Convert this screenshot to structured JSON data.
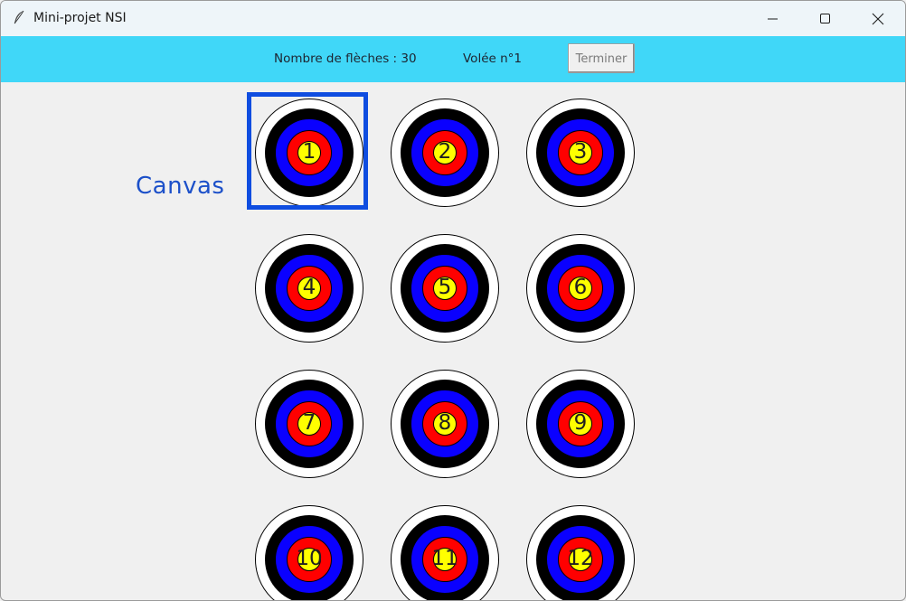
{
  "window": {
    "title": "Mini-projet NSI",
    "minimize_icon": "minimize-icon",
    "maximize_icon": "maximize-icon",
    "close_icon": "close-icon",
    "app_icon": "feather-icon"
  },
  "toolbar": {
    "arrows_label": "Nombre de flèches : 30",
    "volley_label": "Volée n°1",
    "finish_button": "Terminer",
    "background_color": "#40d7f8"
  },
  "canvas_annotation": {
    "label": "Canvas",
    "color": "#1c50c9"
  },
  "targets": [
    {
      "number": "1"
    },
    {
      "number": "2"
    },
    {
      "number": "3"
    },
    {
      "number": "4"
    },
    {
      "number": "5"
    },
    {
      "number": "6"
    },
    {
      "number": "7"
    },
    {
      "number": "8"
    },
    {
      "number": "9"
    },
    {
      "number": "10"
    },
    {
      "number": "11"
    },
    {
      "number": "12"
    }
  ],
  "ring_colors": {
    "outer": "#ffffff",
    "black": "#000000",
    "blue": "#0a00ff",
    "red": "#ff0000",
    "center": "#ffff00"
  }
}
